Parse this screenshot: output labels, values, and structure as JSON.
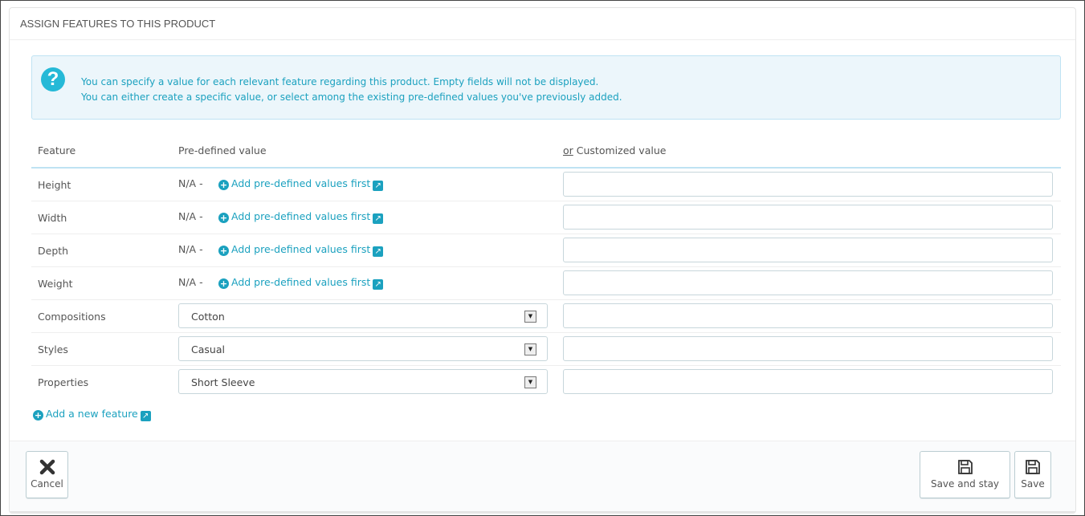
{
  "panel": {
    "title": "ASSIGN FEATURES TO THIS PRODUCT"
  },
  "alert": {
    "icon": "question-icon",
    "icon_glyph": "?",
    "line1": "You can specify a value for each relevant feature regarding this product. Empty fields will not be displayed.",
    "line2": "You can either create a specific value, or select among the existing pre-defined values you've previously added."
  },
  "table": {
    "headers": {
      "feature": "Feature",
      "predefined": "Pre-defined value",
      "or": "or",
      "customized": " Customized value"
    },
    "na_label": "N/A -",
    "add_predefined_label": "Add pre-defined values first",
    "rows": [
      {
        "feature": "Height",
        "type": "na",
        "custom": ""
      },
      {
        "feature": "Width",
        "type": "na",
        "custom": ""
      },
      {
        "feature": "Depth",
        "type": "na",
        "custom": ""
      },
      {
        "feature": "Weight",
        "type": "na",
        "custom": ""
      },
      {
        "feature": "Compositions",
        "type": "select",
        "selected": "Cotton",
        "custom": ""
      },
      {
        "feature": "Styles",
        "type": "select",
        "selected": "Casual",
        "custom": ""
      },
      {
        "feature": "Properties",
        "type": "select",
        "selected": "Short Sleeve",
        "custom": ""
      }
    ]
  },
  "add_feature_label": "Add a new feature",
  "footer": {
    "cancel_label": "Cancel",
    "save_and_stay_label": "Save and stay",
    "save_label": "Save"
  },
  "colors": {
    "accent": "#1ba1bf",
    "alert_bg": "#ecf6fb",
    "alert_border": "#bfe3f3"
  }
}
